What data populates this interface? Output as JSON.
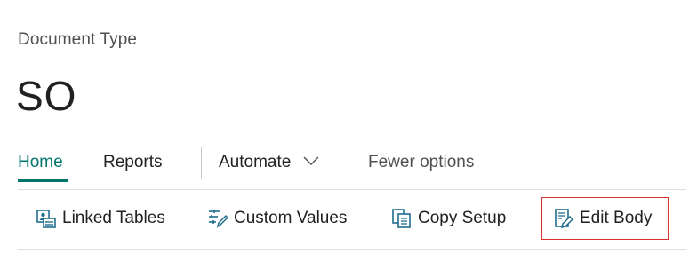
{
  "header": {
    "caption": "Document Type",
    "title": "SO"
  },
  "tabs": [
    {
      "label": "Home",
      "active": true
    },
    {
      "label": "Reports",
      "active": false
    },
    {
      "label": "Automate",
      "active": false,
      "has_dropdown": true
    },
    {
      "label": "Fewer options",
      "active": false
    }
  ],
  "actions": [
    {
      "label": "Linked Tables",
      "icon": "linked-tables-icon"
    },
    {
      "label": "Custom Values",
      "icon": "custom-values-icon"
    },
    {
      "label": "Copy Setup",
      "icon": "copy-setup-icon"
    },
    {
      "label": "Edit Body",
      "icon": "edit-body-icon",
      "highlighted": true
    }
  ],
  "colors": {
    "accent": "#00756c",
    "icon": "#1f6e8c",
    "highlight_border": "#d9332b"
  }
}
